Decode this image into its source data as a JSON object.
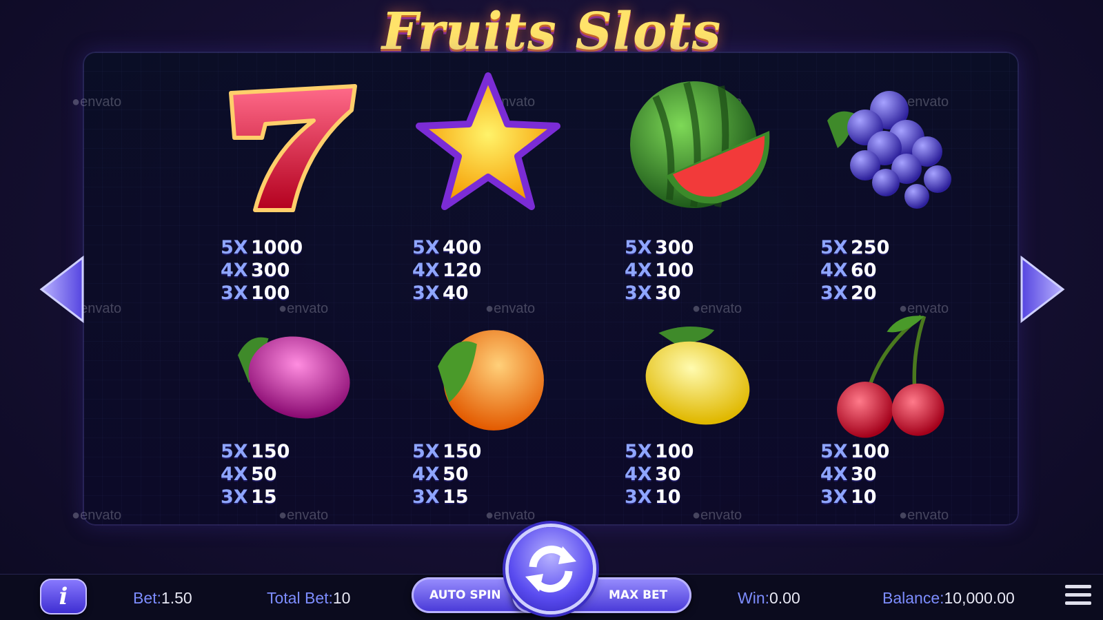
{
  "title": "Fruits Slots",
  "watermark": "envato",
  "symbols": [
    {
      "name": "seven",
      "payouts": [
        {
          "mult": "5X",
          "amount": "1000"
        },
        {
          "mult": "4X",
          "amount": "300"
        },
        {
          "mult": "3X",
          "amount": "100"
        }
      ]
    },
    {
      "name": "star",
      "payouts": [
        {
          "mult": "5X",
          "amount": "400"
        },
        {
          "mult": "4X",
          "amount": "120"
        },
        {
          "mult": "3X",
          "amount": "40"
        }
      ]
    },
    {
      "name": "watermelon",
      "payouts": [
        {
          "mult": "5X",
          "amount": "300"
        },
        {
          "mult": "4X",
          "amount": "100"
        },
        {
          "mult": "3X",
          "amount": "30"
        }
      ]
    },
    {
      "name": "grapes",
      "payouts": [
        {
          "mult": "5X",
          "amount": "250"
        },
        {
          "mult": "4X",
          "amount": "60"
        },
        {
          "mult": "3X",
          "amount": "20"
        }
      ]
    },
    {
      "name": "plum",
      "payouts": [
        {
          "mult": "5X",
          "amount": "150"
        },
        {
          "mult": "4X",
          "amount": "50"
        },
        {
          "mult": "3X",
          "amount": "15"
        }
      ]
    },
    {
      "name": "orange",
      "payouts": [
        {
          "mult": "5X",
          "amount": "150"
        },
        {
          "mult": "4X",
          "amount": "50"
        },
        {
          "mult": "3X",
          "amount": "15"
        }
      ]
    },
    {
      "name": "lemon",
      "payouts": [
        {
          "mult": "5X",
          "amount": "100"
        },
        {
          "mult": "4X",
          "amount": "30"
        },
        {
          "mult": "3X",
          "amount": "10"
        }
      ]
    },
    {
      "name": "cherry",
      "payouts": [
        {
          "mult": "5X",
          "amount": "100"
        },
        {
          "mult": "4X",
          "amount": "30"
        },
        {
          "mult": "3X",
          "amount": "10"
        }
      ]
    }
  ],
  "footer": {
    "info_label": "i",
    "bet_label": "Bet:",
    "bet_value": "1.50",
    "total_bet_label": "Total Bet:",
    "total_bet_value": "10",
    "auto_spin_label": "AUTO SPIN",
    "max_bet_label": "MAX BET",
    "win_label": "Win:",
    "win_value": "0.00",
    "balance_label": "Balance:",
    "balance_value": "10,000.00"
  },
  "colors": {
    "accent": "#5a4cf0",
    "multiplier": "#8fa6ff",
    "title": "#ffe36a"
  }
}
